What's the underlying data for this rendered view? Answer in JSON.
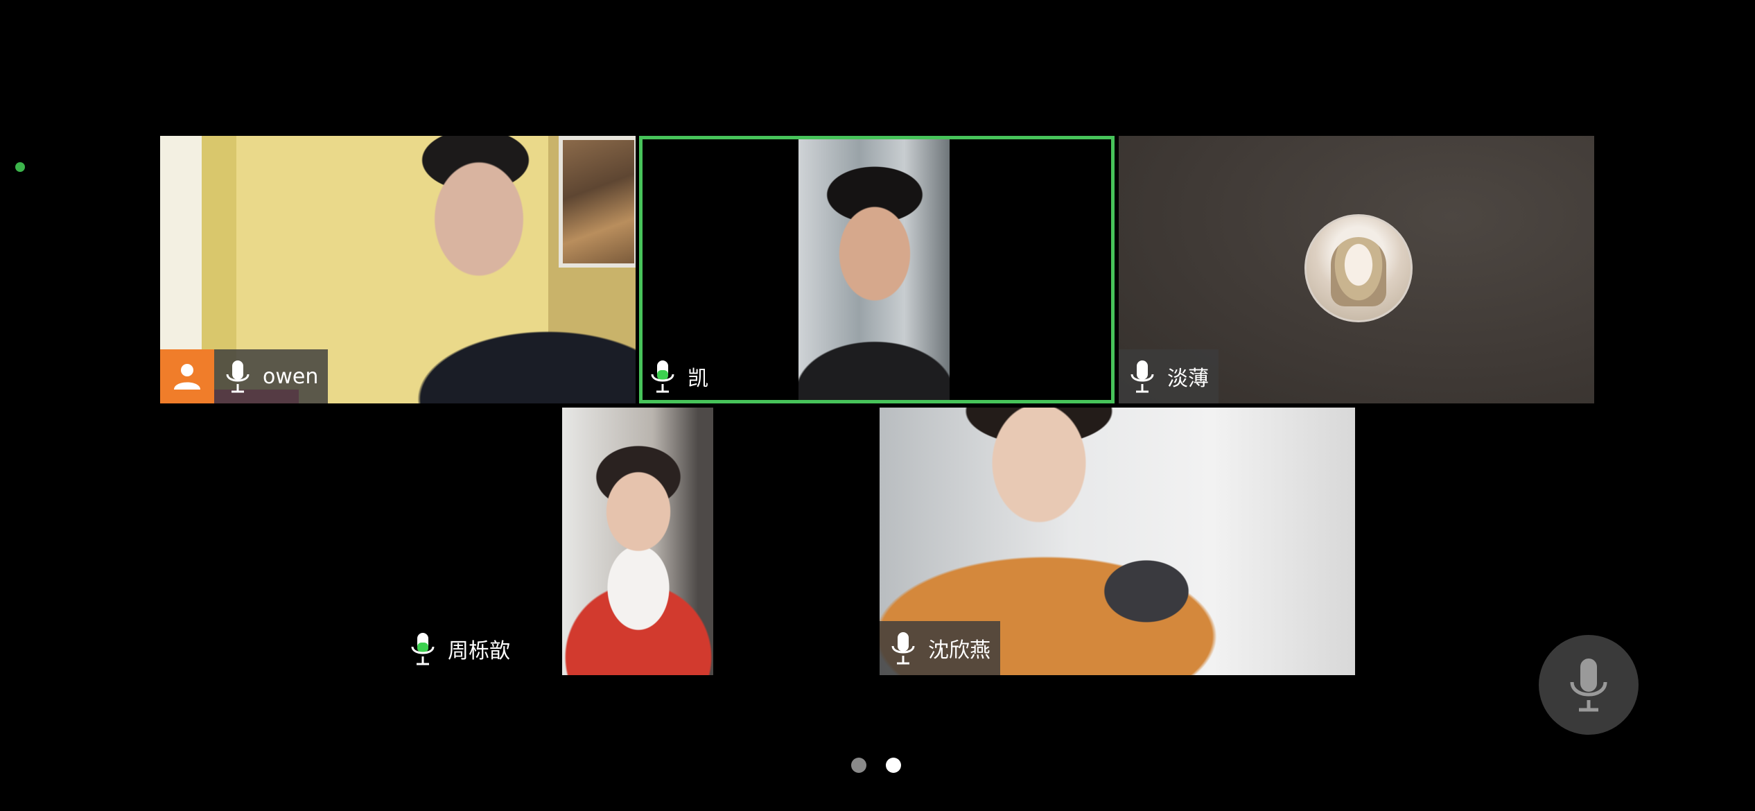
{
  "meeting": {
    "participants": [
      {
        "id": "owen",
        "name": "owen",
        "role": "host",
        "mic": "available",
        "video": "on"
      },
      {
        "id": "kai",
        "name": "凯",
        "mic": "speaking",
        "video": "on",
        "active_speaker": true
      },
      {
        "id": "danbo",
        "name": "淡薄",
        "mic": "available",
        "video": "off",
        "avatar": "anime-girl-avatar"
      },
      {
        "id": "zhou",
        "name": "周栎歆",
        "mic": "speaking",
        "video": "on"
      },
      {
        "id": "shen",
        "name": "沈欣燕",
        "mic": "available",
        "video": "on"
      }
    ]
  },
  "controls": {
    "mic_button": "microphone-icon"
  },
  "pager": {
    "pages": 2,
    "current_page": 2
  },
  "colors": {
    "active_speaker_border": "#47c35a",
    "host_badge": "#f07d2a",
    "speaking_mic": "#3cd04f",
    "status_dot": "#3cb44b"
  }
}
